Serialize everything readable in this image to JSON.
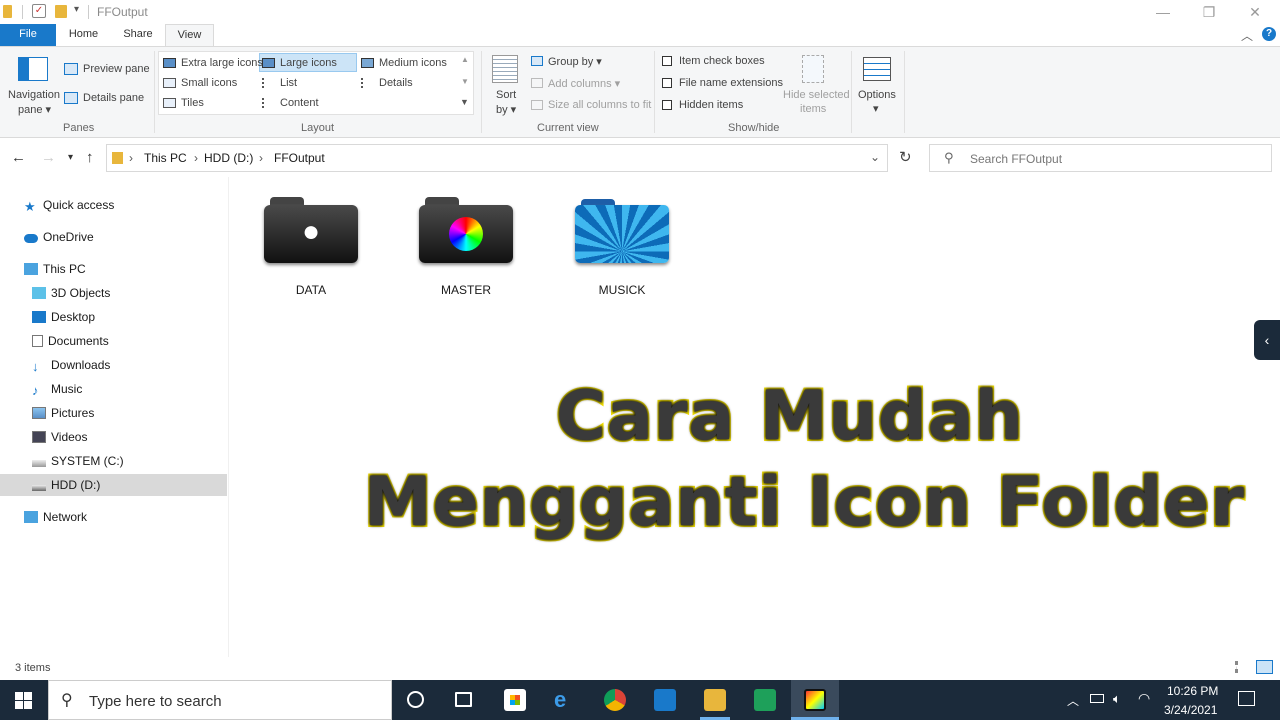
{
  "window": {
    "title": "FFOutput",
    "qat_dropdown": "▾"
  },
  "tabs": [
    {
      "label": "File"
    },
    {
      "label": "Home"
    },
    {
      "label": "Share"
    },
    {
      "label": "View"
    }
  ],
  "ribbon": {
    "panes": {
      "navigation_pane": "Navigation",
      "navigation_pane2": "pane ▾",
      "preview_pane": "Preview pane",
      "details_pane": "Details pane",
      "group_label": "Panes"
    },
    "layout": {
      "extra_large": "Extra large icons",
      "large": "Large icons",
      "medium": "Medium icons",
      "small": "Small icons",
      "list": "List",
      "details": "Details",
      "tiles": "Tiles",
      "content": "Content",
      "group_label": "Layout",
      "selected": "Large icons"
    },
    "current_view": {
      "sort_by": "Sort",
      "sort_by2": "by ▾",
      "group_by": "Group by ▾",
      "add_columns": "Add columns ▾",
      "size_columns": "Size all columns to fit",
      "group_label": "Current view"
    },
    "show_hide": {
      "item_check_boxes": "Item check boxes",
      "file_name_extensions": "File name extensions",
      "hidden_items": "Hidden items",
      "hide_selected": "Hide selected",
      "hide_selected2": "items",
      "group_label": "Show/hide"
    },
    "options": {
      "label": "Options",
      "label2": "▾"
    }
  },
  "address_bar": {
    "crumbs": [
      "This PC",
      "HDD (D:)",
      "FFOutput"
    ],
    "search_placeholder": "Search FFOutput"
  },
  "nav_pane": {
    "items": [
      {
        "label": "Quick access",
        "icon": "star-icon"
      },
      {
        "label": "OneDrive",
        "icon": "cloud-icon"
      },
      {
        "label": "This PC",
        "icon": "computer-icon"
      },
      {
        "label": "3D Objects",
        "icon": "cube-icon"
      },
      {
        "label": "Desktop",
        "icon": "desktop-icon"
      },
      {
        "label": "Documents",
        "icon": "document-icon"
      },
      {
        "label": "Downloads",
        "icon": "download-icon"
      },
      {
        "label": "Music",
        "icon": "music-icon"
      },
      {
        "label": "Pictures",
        "icon": "picture-icon"
      },
      {
        "label": "Videos",
        "icon": "video-icon"
      },
      {
        "label": "SYSTEM (C:)",
        "icon": "drive-icon"
      },
      {
        "label": "HDD (D:)",
        "icon": "drive-icon"
      },
      {
        "label": "Network",
        "icon": "network-icon"
      }
    ],
    "selected": "HDD (D:)"
  },
  "folders": [
    {
      "label": "DATA",
      "icon": "apple-folder-icon"
    },
    {
      "label": "MASTER",
      "icon": "color-wheel-folder-icon"
    },
    {
      "label": "MUSICK",
      "icon": "blue-burst-folder-icon"
    }
  ],
  "overlay": {
    "line1": "Cara Mudah",
    "line2": "Mengganti Icon Folder",
    "fill_color": "#3a3a3a",
    "stroke_color": "#f4e100"
  },
  "status": {
    "item_count": "3 items"
  },
  "taskbar": {
    "search_placeholder": "Type here to search",
    "time": "10:26 PM",
    "date": "3/24/2021"
  },
  "colors": {
    "accent": "#1979ca",
    "taskbar": "#1b2a3a",
    "selection": "#cce4f7"
  }
}
